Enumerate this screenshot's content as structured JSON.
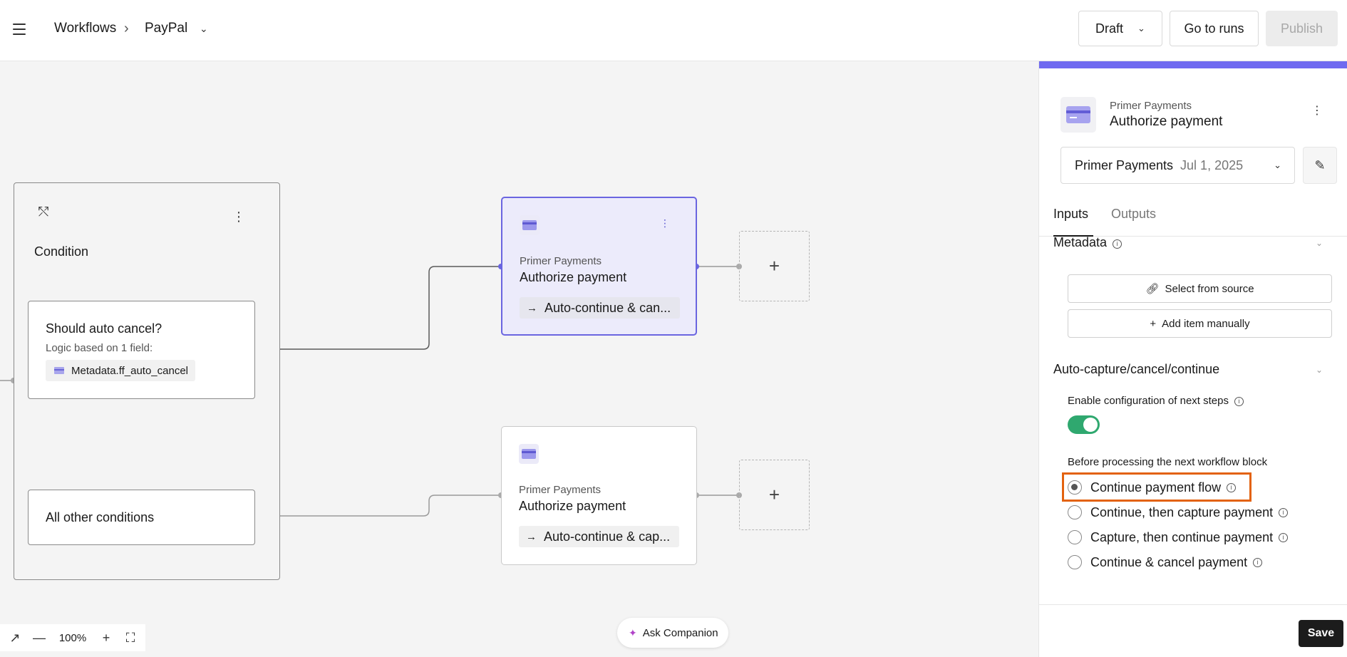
{
  "topbar": {
    "breadcrumb_root": "Workflows",
    "breadcrumb_sep": "›",
    "breadcrumb_current": "PayPal",
    "status_select": "Draft",
    "go_to_runs": "Go to runs",
    "publish": "Publish"
  },
  "canvas": {
    "condition": {
      "title": "Condition",
      "branch1_title": "Should auto cancel?",
      "branch1_sub": "Logic based on 1 field:",
      "branch1_field": "Metadata.ff_auto_cancel",
      "branch2_title": "All other conditions"
    },
    "nodes": [
      {
        "provider": "Primer Payments",
        "title": "Authorize payment",
        "next": "Auto-continue & can...",
        "selected": true
      },
      {
        "provider": "Primer Payments",
        "title": "Authorize payment",
        "next": "Auto-continue & cap...",
        "selected": false
      }
    ],
    "zoom": "100%",
    "companion": "Ask Companion"
  },
  "panel": {
    "provider": "Primer Payments",
    "title": "Authorize payment",
    "version_provider": "Primer Payments",
    "version_date": "Jul 1, 2025",
    "tabs": [
      "Inputs",
      "Outputs"
    ],
    "metadata_title": "Metadata",
    "select_from_source": "Select from source",
    "add_item_manually": "Add item manually",
    "auto_section_title": "Auto-capture/cancel/continue",
    "enable_label": "Enable configuration of next steps",
    "before_label": "Before processing the next workflow block",
    "options": [
      "Continue payment flow",
      "Continue, then capture payment",
      "Capture, then continue payment",
      "Continue & cancel payment"
    ],
    "selected_option": 0,
    "save": "Save"
  },
  "colors": {
    "accent": "#6f6af0",
    "toggle_on": "#2fa86f",
    "highlight": "#e3620e"
  }
}
